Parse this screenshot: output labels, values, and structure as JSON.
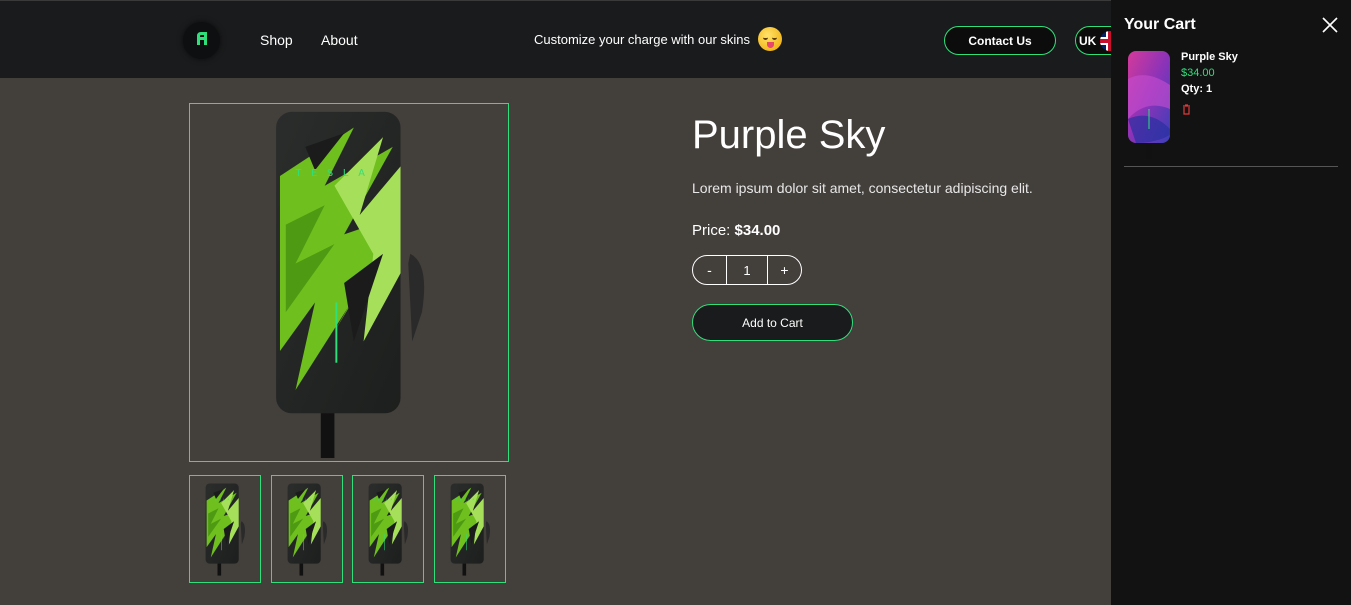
{
  "header": {
    "logo_icon": "charger-logo-icon",
    "nav": [
      {
        "label": "Shop"
      },
      {
        "label": "About"
      }
    ],
    "promo_text": "Customize your charge with our skins",
    "promo_icon": "tongue-out-emoji-icon",
    "contact_label": "Contact Us",
    "language_label": "UK",
    "language_icon": "uk-flag-icon"
  },
  "product": {
    "title": "Purple Sky",
    "description": "Lorem ipsum dolor sit amet, consectetur adipiscing elit.",
    "price_label": "Price:",
    "price": "$34.00",
    "quantity": {
      "minus": "-",
      "value": "1",
      "plus": "+"
    },
    "add_to_cart_label": "Add to Cart",
    "image": "green-lightning-wall-charger-skin",
    "thumbnail_count": 4
  },
  "cart": {
    "title": "Your Cart",
    "close_icon": "close-icon",
    "items": [
      {
        "name": "Purple Sky",
        "price": "$34.00",
        "qty": "Qty: 1",
        "image": "purple-wall-charger-skin",
        "remove_icon": "trash-icon"
      }
    ]
  },
  "colors": {
    "accent": "#2fe07a",
    "header_bg": "#1a1b1c",
    "page_bg": "#433f3b",
    "cart_bg": "#121212",
    "danger": "#e23a3a"
  }
}
